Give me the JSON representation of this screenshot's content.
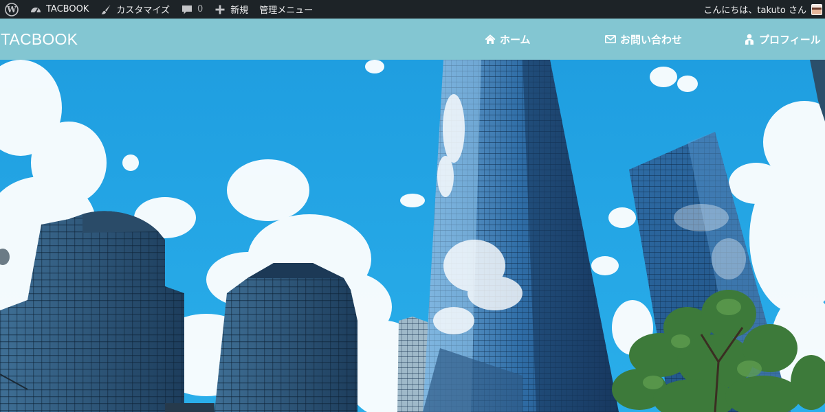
{
  "admin_bar": {
    "site_name": "TACBOOK",
    "customize_label": "カスタマイズ",
    "comments_count": "0",
    "new_label": "新規",
    "admin_menu_label": "管理メニュー",
    "greeting": "こんにちは、takuto さん",
    "icons": {
      "wordpress": "wordpress-logo-icon",
      "dashboard": "dashboard-icon",
      "customize": "brush-icon",
      "comments": "comment-bubble-icon",
      "new": "plus-icon"
    },
    "colors": {
      "background": "#1d2327",
      "text": "#f0f0f1"
    }
  },
  "header": {
    "site_title": "TACBOOK",
    "nav": [
      {
        "label": "ホーム",
        "icon": "home-icon"
      },
      {
        "label": "お問い合わせ",
        "icon": "envelope-icon"
      },
      {
        "label": "プロフィール",
        "icon": "user-icon"
      }
    ],
    "colors": {
      "background": "#83c6d2",
      "text": "#ffffff"
    }
  },
  "hero": {
    "image": "city-skyscrapers-blue-sky"
  }
}
